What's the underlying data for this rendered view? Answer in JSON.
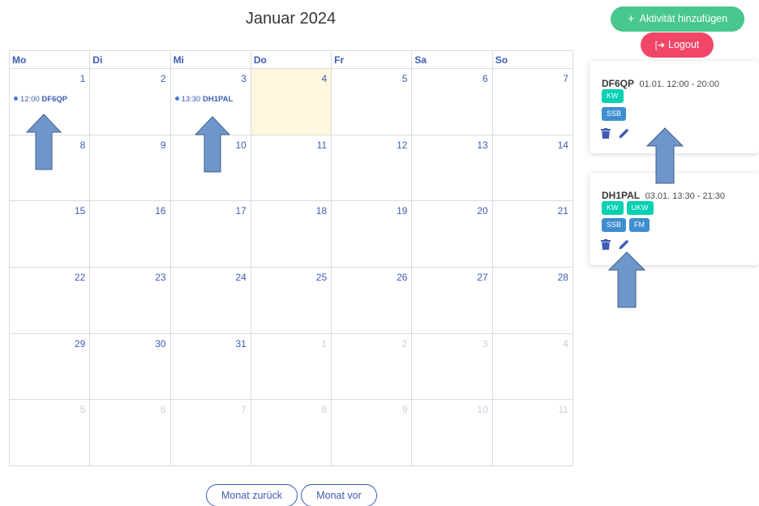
{
  "header": {
    "title": "Januar 2024"
  },
  "actions": {
    "add_label": "Aktivität hinzufügen",
    "logout_label": "Logout"
  },
  "weekdays": [
    "Mo",
    "Di",
    "Mi",
    "Do",
    "Fr",
    "Sa",
    "So"
  ],
  "days": [
    {
      "n": "1",
      "other": false,
      "today": false,
      "event": {
        "time": "12:00",
        "call": "DF6QP"
      }
    },
    {
      "n": "2",
      "other": false,
      "today": false
    },
    {
      "n": "3",
      "other": false,
      "today": false,
      "event": {
        "time": "13:30",
        "call": "DH1PAL"
      }
    },
    {
      "n": "4",
      "other": false,
      "today": true
    },
    {
      "n": "5",
      "other": false,
      "today": false
    },
    {
      "n": "6",
      "other": false,
      "today": false
    },
    {
      "n": "7",
      "other": false,
      "today": false
    },
    {
      "n": "8",
      "other": false,
      "today": false
    },
    {
      "n": "9",
      "other": false,
      "today": false
    },
    {
      "n": "10",
      "other": false,
      "today": false
    },
    {
      "n": "11",
      "other": false,
      "today": false
    },
    {
      "n": "12",
      "other": false,
      "today": false
    },
    {
      "n": "13",
      "other": false,
      "today": false
    },
    {
      "n": "14",
      "other": false,
      "today": false
    },
    {
      "n": "15",
      "other": false,
      "today": false
    },
    {
      "n": "16",
      "other": false,
      "today": false
    },
    {
      "n": "17",
      "other": false,
      "today": false
    },
    {
      "n": "18",
      "other": false,
      "today": false
    },
    {
      "n": "19",
      "other": false,
      "today": false
    },
    {
      "n": "20",
      "other": false,
      "today": false
    },
    {
      "n": "21",
      "other": false,
      "today": false
    },
    {
      "n": "22",
      "other": false,
      "today": false
    },
    {
      "n": "23",
      "other": false,
      "today": false
    },
    {
      "n": "24",
      "other": false,
      "today": false
    },
    {
      "n": "25",
      "other": false,
      "today": false
    },
    {
      "n": "26",
      "other": false,
      "today": false
    },
    {
      "n": "27",
      "other": false,
      "today": false
    },
    {
      "n": "28",
      "other": false,
      "today": false
    },
    {
      "n": "29",
      "other": false,
      "today": false
    },
    {
      "n": "30",
      "other": false,
      "today": false
    },
    {
      "n": "31",
      "other": false,
      "today": false
    },
    {
      "n": "1",
      "other": true,
      "today": false
    },
    {
      "n": "2",
      "other": true,
      "today": false
    },
    {
      "n": "3",
      "other": true,
      "today": false
    },
    {
      "n": "4",
      "other": true,
      "today": false
    },
    {
      "n": "5",
      "other": true,
      "today": false
    },
    {
      "n": "6",
      "other": true,
      "today": false
    },
    {
      "n": "7",
      "other": true,
      "today": false
    },
    {
      "n": "8",
      "other": true,
      "today": false
    },
    {
      "n": "9",
      "other": true,
      "today": false
    },
    {
      "n": "10",
      "other": true,
      "today": false
    },
    {
      "n": "11",
      "other": true,
      "today": false
    }
  ],
  "activities": [
    {
      "call": "DF6QP",
      "time": "01.01. 12:00 - 20:00",
      "bands": [
        "KW"
      ],
      "modes": [
        "SSB"
      ]
    },
    {
      "call": "DH1PAL",
      "time": "03.01. 13:30 - 21:30",
      "bands": [
        "KW",
        "UKW"
      ],
      "modes": [
        "SSB",
        "FM"
      ]
    }
  ],
  "nav": {
    "prev_label": "Monat zurück",
    "next_label": "Monat vor"
  },
  "icons": {
    "add": "plus-icon",
    "logout": "logout-icon",
    "delete": "trash-icon",
    "edit": "pencil-icon",
    "annotation": "arrow-up-icon"
  },
  "colors": {
    "primary": "#3e5bb5",
    "success": "#48c78e",
    "danger": "#f14668",
    "today": "#fef7de",
    "tag_band": "#00d1b2",
    "tag_mode": "#3e8ed0",
    "annotation_arrow": "#6f96ca"
  }
}
